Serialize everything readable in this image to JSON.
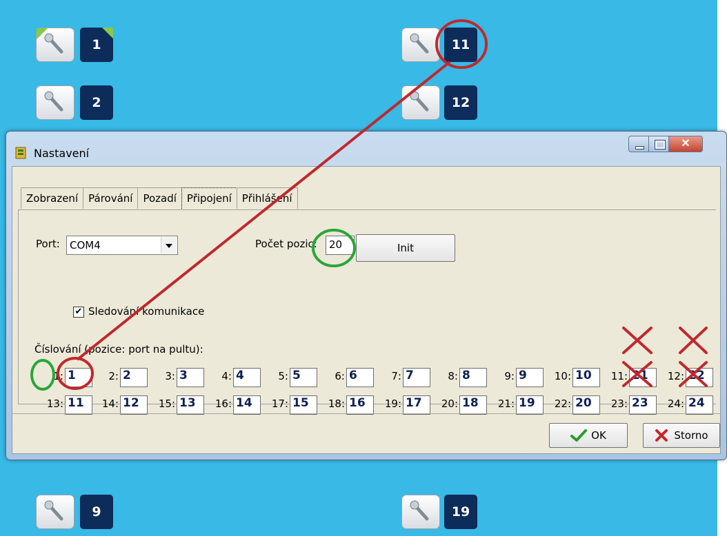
{
  "background": {
    "color": "#38b9e6",
    "positions_left": [
      {
        "number": "1",
        "active": true
      },
      {
        "number": "2",
        "active": false
      },
      {
        "number": "9",
        "active": false
      }
    ],
    "positions_right": [
      {
        "number": "11",
        "active": false
      },
      {
        "number": "12",
        "active": false
      },
      {
        "number": "19",
        "active": false
      }
    ]
  },
  "window": {
    "title": "Nastavení",
    "tabs": [
      "Zobrazení",
      "Párování",
      "Pozadí",
      "Připojení",
      "Přihlášení"
    ],
    "active_tab": "Připojení"
  },
  "connection": {
    "port_label": "Port:",
    "port_value": "COM4",
    "count_label": "Počet pozic:",
    "count_value": "20",
    "init_label": "Init",
    "tracking_label": "Sledování komunikace",
    "tracking_checked": "✔",
    "numbering_label": "Číslování (pozice: port na pultu):"
  },
  "mapping_row1": [
    {
      "pos": "1:",
      "port": "1"
    },
    {
      "pos": "2:",
      "port": "2"
    },
    {
      "pos": "3:",
      "port": "3"
    },
    {
      "pos": "4:",
      "port": "4"
    },
    {
      "pos": "5:",
      "port": "5"
    },
    {
      "pos": "6:",
      "port": "6"
    },
    {
      "pos": "7:",
      "port": "7"
    },
    {
      "pos": "8:",
      "port": "8"
    },
    {
      "pos": "9:",
      "port": "9"
    },
    {
      "pos": "10:",
      "port": "10"
    },
    {
      "pos": "11:",
      "port": "21"
    },
    {
      "pos": "12:",
      "port": "22"
    }
  ],
  "mapping_row2": [
    {
      "pos": "13:",
      "port": "11"
    },
    {
      "pos": "14:",
      "port": "12"
    },
    {
      "pos": "15:",
      "port": "13"
    },
    {
      "pos": "16:",
      "port": "14"
    },
    {
      "pos": "17:",
      "port": "15"
    },
    {
      "pos": "18:",
      "port": "16"
    },
    {
      "pos": "19:",
      "port": "17"
    },
    {
      "pos": "20:",
      "port": "18"
    },
    {
      "pos": "21:",
      "port": "19"
    },
    {
      "pos": "22:",
      "port": "20"
    },
    {
      "pos": "23:",
      "port": "23"
    },
    {
      "pos": "24:",
      "port": "24"
    }
  ],
  "buttons": {
    "ok": "OK",
    "cancel": "Storno"
  },
  "annotation_colors": {
    "red": "#c0282e",
    "green": "#2aa63a"
  }
}
